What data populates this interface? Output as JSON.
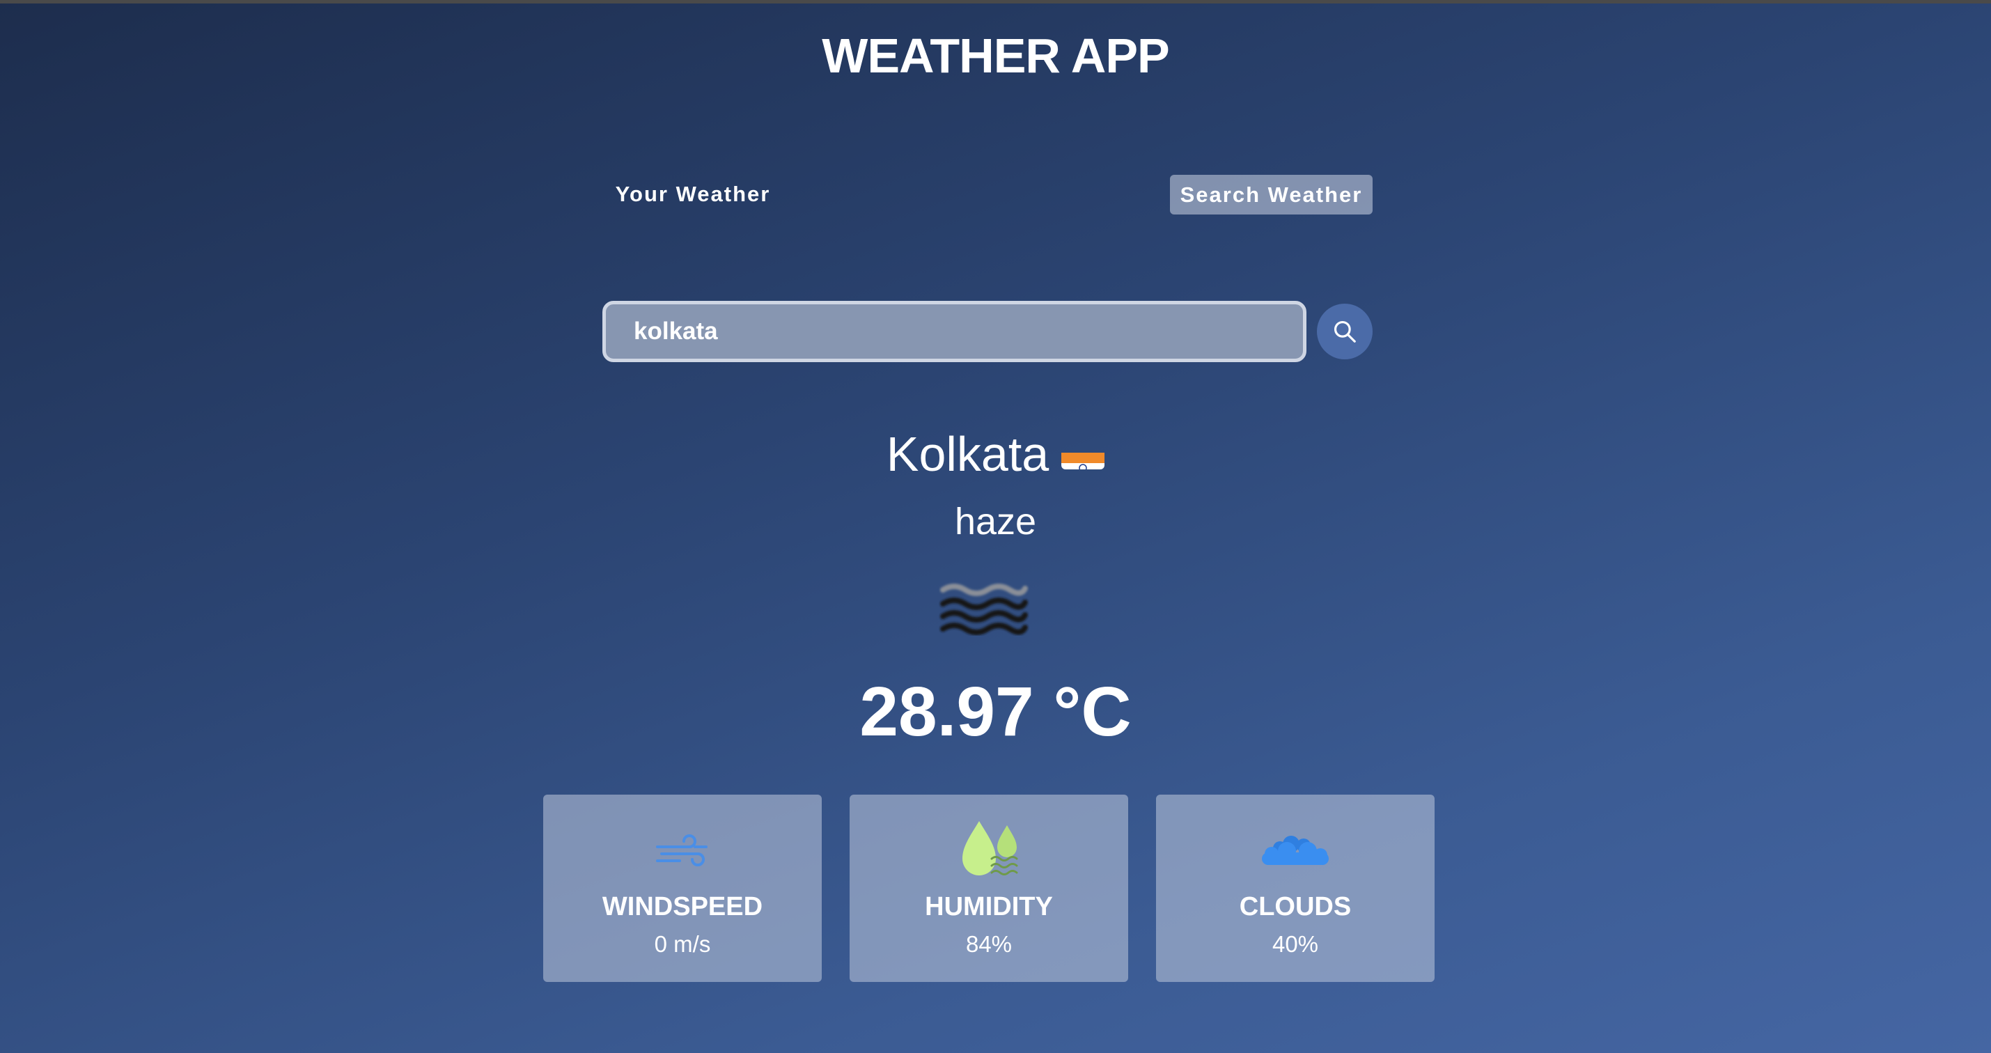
{
  "app": {
    "title": "WEATHER APP"
  },
  "tabs": {
    "your_weather": "Your Weather",
    "search_weather": "Search Weather"
  },
  "search": {
    "value": "kolkata",
    "button_icon": "search-icon"
  },
  "weather": {
    "city": "Kolkata",
    "country_flag": "india-flag-icon",
    "description": "haze",
    "condition_icon": "haze-icon",
    "temperature": "28.97 °C"
  },
  "stats": [
    {
      "label": "WINDSPEED",
      "value": "0 m/s",
      "icon": "wind-icon"
    },
    {
      "label": "HUMIDITY",
      "value": "84%",
      "icon": "humidity-icon"
    },
    {
      "label": "CLOUDS",
      "value": "40%",
      "icon": "cloud-icon"
    }
  ],
  "colors": {
    "background_top": "#1d2d4d",
    "background_bottom": "#4566a3",
    "search_button": "#4b6ba8",
    "wind_icon": "#4a8ee6",
    "humidity_icon": "#c7ef8c",
    "cloud_icon": "#3a8ef0"
  }
}
